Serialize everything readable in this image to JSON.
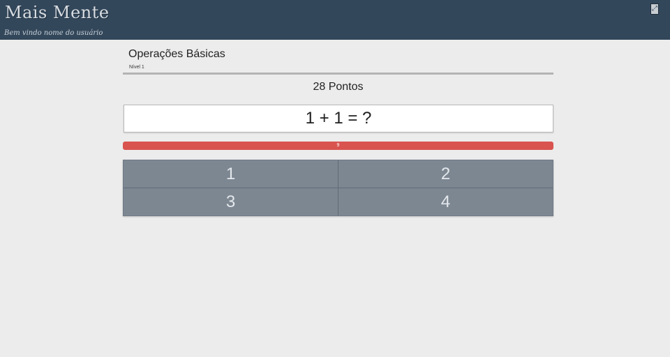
{
  "app": {
    "brand": "Mais Mente",
    "welcome": "Bem vindo nome do usuário",
    "expand_icon": "expand-icon"
  },
  "game": {
    "title": "Operações Básicas",
    "level": "Nível 1",
    "score": "28 Pontos",
    "question": "1 + 1 = ?",
    "timer": {
      "label": "9",
      "fraction_remaining": 1.0,
      "color": "#d9534f"
    },
    "answers": [
      "1",
      "2",
      "3",
      "4"
    ]
  },
  "colors": {
    "topbar": "#33475b",
    "answer_button": "#7d8792",
    "background": "#ececec"
  }
}
